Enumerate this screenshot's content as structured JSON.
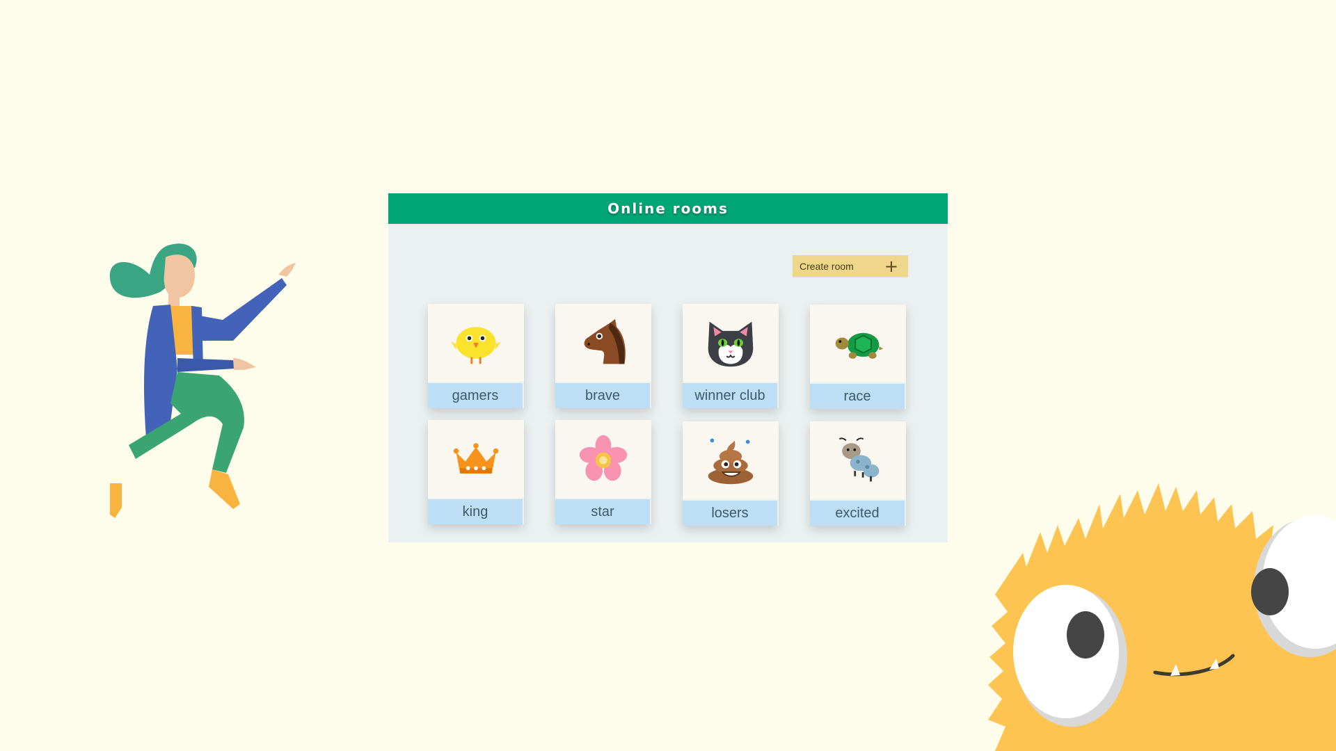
{
  "panel": {
    "title": "Online rooms",
    "create_button": {
      "label": "Create room",
      "icon": "plus-icon"
    }
  },
  "rooms": [
    {
      "name": "gamers",
      "icon": "chick-icon"
    },
    {
      "name": "brave",
      "icon": "horse-icon"
    },
    {
      "name": "winner club",
      "icon": "cat-icon"
    },
    {
      "name": "race",
      "icon": "turtle-icon"
    },
    {
      "name": "king",
      "icon": "crown-icon"
    },
    {
      "name": "star",
      "icon": "flower-icon"
    },
    {
      "name": "losers",
      "icon": "poop-icon"
    },
    {
      "name": "excited",
      "icon": "bug-icon"
    }
  ],
  "colors": {
    "background": "#fefdec",
    "header": "#00a676",
    "panel": "#ebf0f1",
    "button": "#eed68a",
    "label_bg": "#bddef5",
    "monster": "#fdc451"
  }
}
